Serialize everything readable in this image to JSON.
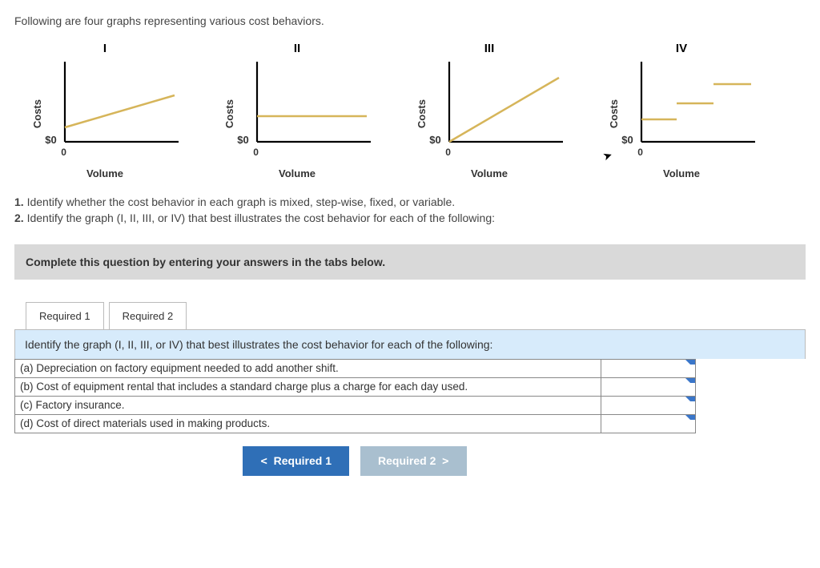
{
  "intro": "Following are four graphs representing various cost behaviors.",
  "graphs": {
    "ylabel": "Costs",
    "xlabel": "Volume",
    "y_origin": "$0",
    "x_origin": "0",
    "items": [
      {
        "title": "I"
      },
      {
        "title": "II"
      },
      {
        "title": "III"
      },
      {
        "title": "IV"
      }
    ]
  },
  "questions": {
    "q1_num": "1.",
    "q1_text": " Identify whether the cost behavior in each graph is mixed, step-wise, fixed, or variable.",
    "q2_num": "2.",
    "q2_text": " Identify the graph (I, II, III, or IV) that best illustrates the cost behavior for each of the following:"
  },
  "complete_instruction": "Complete this question by entering your answers in the tabs below.",
  "tabs": {
    "t1": "Required 1",
    "t2": "Required 2"
  },
  "prompt": "Identify the graph (I, II, III, or IV) that best illustrates the cost behavior for each of the following:",
  "rows": {
    "a": "(a) Depreciation on factory equipment needed to add another shift.",
    "b": "(b) Cost of equipment rental that includes a standard charge plus a charge for each day used.",
    "c": "(c) Factory insurance.",
    "d": "(d) Cost of direct materials used in making products."
  },
  "nav": {
    "prev": "Required 1",
    "next": "Required 2"
  },
  "chart_data": [
    {
      "type": "line",
      "title": "I",
      "xlabel": "Volume",
      "ylabel": "Costs",
      "x": [
        0,
        10
      ],
      "y": [
        2,
        6
      ],
      "ylim": [
        0,
        10
      ],
      "xlim": [
        0,
        10
      ],
      "description": "Mixed cost: positive intercept, positive slope"
    },
    {
      "type": "line",
      "title": "II",
      "xlabel": "Volume",
      "ylabel": "Costs",
      "x": [
        0,
        10
      ],
      "y": [
        3.5,
        3.5
      ],
      "ylim": [
        0,
        10
      ],
      "xlim": [
        0,
        10
      ],
      "description": "Fixed cost: horizontal line above origin"
    },
    {
      "type": "line",
      "title": "III",
      "xlabel": "Volume",
      "ylabel": "Costs",
      "x": [
        0,
        10
      ],
      "y": [
        0,
        8
      ],
      "ylim": [
        0,
        10
      ],
      "xlim": [
        0,
        10
      ],
      "description": "Variable cost: line through origin, positive slope"
    },
    {
      "type": "line",
      "title": "IV",
      "xlabel": "Volume",
      "ylabel": "Costs",
      "series": [
        {
          "name": "step1",
          "x": [
            0,
            3.3
          ],
          "y": [
            3,
            3
          ]
        },
        {
          "name": "step2",
          "x": [
            3.3,
            6.6
          ],
          "y": [
            5,
            5
          ]
        },
        {
          "name": "step3",
          "x": [
            6.6,
            10
          ],
          "y": [
            7.5,
            7.5
          ]
        }
      ],
      "ylim": [
        0,
        10
      ],
      "xlim": [
        0,
        10
      ],
      "description": "Step-wise cost: discrete horizontal steps increasing"
    }
  ]
}
